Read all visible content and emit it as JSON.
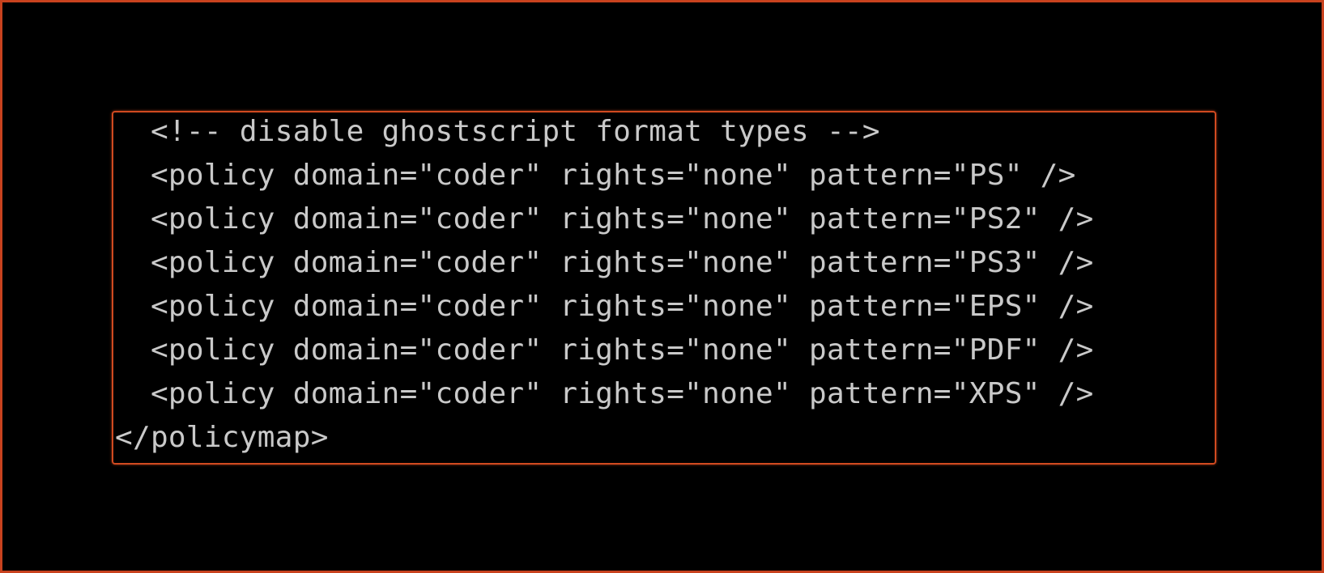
{
  "colors": {
    "background": "#000000",
    "border": "#c8421e",
    "highlight": "#d04a20",
    "text": "#c9c9c9"
  },
  "terminal": {
    "lines": [
      "  <!-- disable ghostscript format types -->",
      "  <policy domain=\"coder\" rights=\"none\" pattern=\"PS\" />",
      "  <policy domain=\"coder\" rights=\"none\" pattern=\"PS2\" />",
      "  <policy domain=\"coder\" rights=\"none\" pattern=\"PS3\" />",
      "  <policy domain=\"coder\" rights=\"none\" pattern=\"EPS\" />",
      "  <policy domain=\"coder\" rights=\"none\" pattern=\"PDF\" />",
      "  <policy domain=\"coder\" rights=\"none\" pattern=\"XPS\" />",
      "</policymap>"
    ]
  }
}
